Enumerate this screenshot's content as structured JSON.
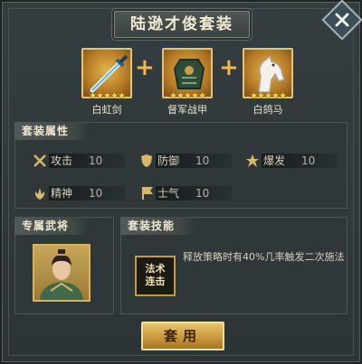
{
  "dialog": {
    "title": "陆逊才俊套装"
  },
  "items": [
    {
      "name": "白虹剑",
      "stars": "★★★★★",
      "icon": "sword-icon"
    },
    {
      "name": "督军战甲",
      "stars": "★★★★★",
      "icon": "armor-icon"
    },
    {
      "name": "白鸽马",
      "stars": "★★★★★",
      "icon": "horse-icon"
    }
  ],
  "plus_symbol": "+",
  "attributes": {
    "label": "套装属性",
    "list": [
      {
        "name": "攻击",
        "value": "10",
        "icon": "attack-icon"
      },
      {
        "name": "防御",
        "value": "10",
        "icon": "defense-icon"
      },
      {
        "name": "爆发",
        "value": "10",
        "icon": "burst-icon"
      },
      {
        "name": "精神",
        "value": "10",
        "icon": "spirit-icon"
      },
      {
        "name": "士气",
        "value": "10",
        "icon": "morale-icon"
      }
    ]
  },
  "exclusive": {
    "label": "专属武将"
  },
  "skill": {
    "label": "套装技能",
    "icon_text": "法术\n连击",
    "description": "释放策略时有40%几率触发二次施法"
  },
  "apply_button": "套用",
  "colors": {
    "gold": "#e4c37a",
    "panel": "#343d3f",
    "text": "#d7d0bd"
  }
}
